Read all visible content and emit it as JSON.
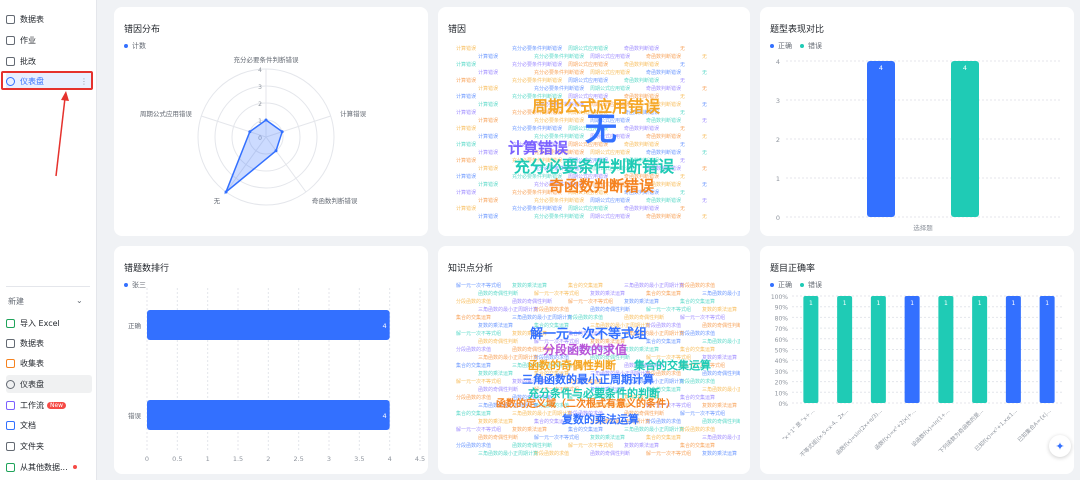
{
  "sidebar": {
    "top_items": [
      {
        "label": "数据表"
      },
      {
        "label": "作业"
      },
      {
        "label": "批改"
      },
      {
        "label": "仪表盘"
      }
    ],
    "new_label": "新建",
    "new_items": [
      {
        "label": "导入 Excel"
      },
      {
        "label": "数据表"
      },
      {
        "label": "收集表"
      },
      {
        "label": "仪表盘"
      },
      {
        "label": "工作流",
        "badge": "New"
      },
      {
        "label": "文档"
      },
      {
        "label": "文件夹"
      },
      {
        "label": "从其他数据..."
      }
    ]
  },
  "cards": {
    "error_dist": {
      "title": "错因分布",
      "legend": "计数"
    },
    "error_cloud": {
      "title": "错因"
    },
    "type_compare": {
      "title": "题型表现对比",
      "legend": [
        "正确",
        "错误"
      ]
    },
    "error_rank": {
      "title": "错题数排行",
      "legend": "张三"
    },
    "knowledge": {
      "title": "知识点分析"
    },
    "accuracy": {
      "title": "题目正确率",
      "legend": [
        "正确",
        "错误"
      ]
    }
  },
  "colors": {
    "blue": "#3370ff",
    "teal": "#1fcbb5",
    "accent": "#3370ff"
  },
  "chart_data": [
    {
      "type": "radar",
      "title": "错因分布",
      "categories": [
        "充分必要条件判断错误",
        "计算错误",
        "奇函数判断错误",
        "无",
        "周期公式应用错误"
      ],
      "series": [
        {
          "name": "计数",
          "values": [
            1,
            1,
            1,
            4,
            1
          ]
        }
      ],
      "ticks": [
        "0",
        "1",
        "2",
        "3",
        "4"
      ],
      "rmax": 4
    },
    {
      "type": "bar",
      "title": "题型表现对比",
      "categories": [
        "选择题"
      ],
      "series": [
        {
          "name": "正确",
          "values": [
            4
          ]
        },
        {
          "name": "错误",
          "values": [
            4
          ]
        }
      ],
      "yticks": [
        "0",
        "1",
        "2",
        "3",
        "4"
      ],
      "ylim": [
        0,
        4
      ]
    },
    {
      "type": "bar",
      "orientation": "horizontal",
      "title": "错题数排行",
      "categories": [
        "正确",
        "错误"
      ],
      "series": [
        {
          "name": "张三",
          "values": [
            4,
            4
          ]
        }
      ],
      "xticks": [
        "0",
        "0.5",
        "1",
        "1.5",
        "2",
        "2.5",
        "3",
        "3.5",
        "4",
        "4.5"
      ],
      "xlim": [
        0,
        4.5
      ]
    },
    {
      "type": "bar",
      "stacked": true,
      "title": "题目正确率",
      "categories": [
        "\"x＋1\" 是 \"x＋...",
        "不等式组|(x-5<x-4、2x...",
        "函数f(x)=sin(2x+π/3)...",
        "函数f(x)=x²+2|x|+...",
        "设函数f(x)=ln(1+...",
        "下列函数为奇函数的是...",
        "已知f(x)=x²+1,x≤1...",
        "已知集合A={x|..."
      ],
      "series": [
        {
          "name": "正确",
          "values": [
            1,
            1,
            1,
            0,
            1,
            1,
            0,
            0
          ],
          "labels": [
            "1",
            "1",
            "1",
            "",
            "1",
            "1",
            "",
            ""
          ]
        },
        {
          "name": "错误",
          "values": [
            0,
            0,
            0,
            1,
            0,
            0,
            1,
            1
          ],
          "labels": [
            "",
            "",
            "",
            "1",
            "",
            "",
            "1",
            "1"
          ]
        }
      ],
      "yticks": [
        "0%",
        "10%",
        "20%",
        "30%",
        "40%",
        "50%",
        "60%",
        "70%",
        "80%",
        "90%",
        "100%"
      ],
      "ylim": [
        0,
        1
      ]
    }
  ],
  "wordclouds": {
    "error": {
      "big": [
        {
          "text": "无",
          "color": "#3370ff"
        },
        {
          "text": "周期公式应用错误",
          "color": "#f5a623"
        },
        {
          "text": "计算错误",
          "color": "#7b61ff"
        },
        {
          "text": "充分必要条件判断错误",
          "color": "#1fcbb5"
        },
        {
          "text": "奇函数判断错误",
          "color": "#f5821f"
        }
      ],
      "small": [
        "计算错误",
        "充分必要条件判断错误",
        "周期公式应用错误",
        "奇函数判断错误",
        "无"
      ]
    },
    "knowledge": {
      "big": [
        {
          "text": "解一元一次不等式组",
          "color": "#3370ff"
        },
        {
          "text": "分段函数的求值",
          "color": "#b855d8"
        },
        {
          "text": "函数的奇偶性判断",
          "color": "#f5a623"
        },
        {
          "text": "集合的交集运算",
          "color": "#1fcbb5"
        },
        {
          "text": "三角函数的最小正周期计算",
          "color": "#3370ff"
        },
        {
          "text": "充分条件与必要条件的判断",
          "color": "#1fcbb5"
        },
        {
          "text": "函数的定义域（二次根式有意义的条件）",
          "color": "#f5821f"
        },
        {
          "text": "复数的乘法运算",
          "color": "#3370ff"
        }
      ],
      "small": [
        "解一元一次不等式组",
        "复数的乘法运算",
        "集合的交集运算",
        "三角函数的最小正周期计算",
        "分段函数的求值",
        "函数的奇偶性判断"
      ]
    }
  },
  "fab_icon": "sparkle-icon"
}
